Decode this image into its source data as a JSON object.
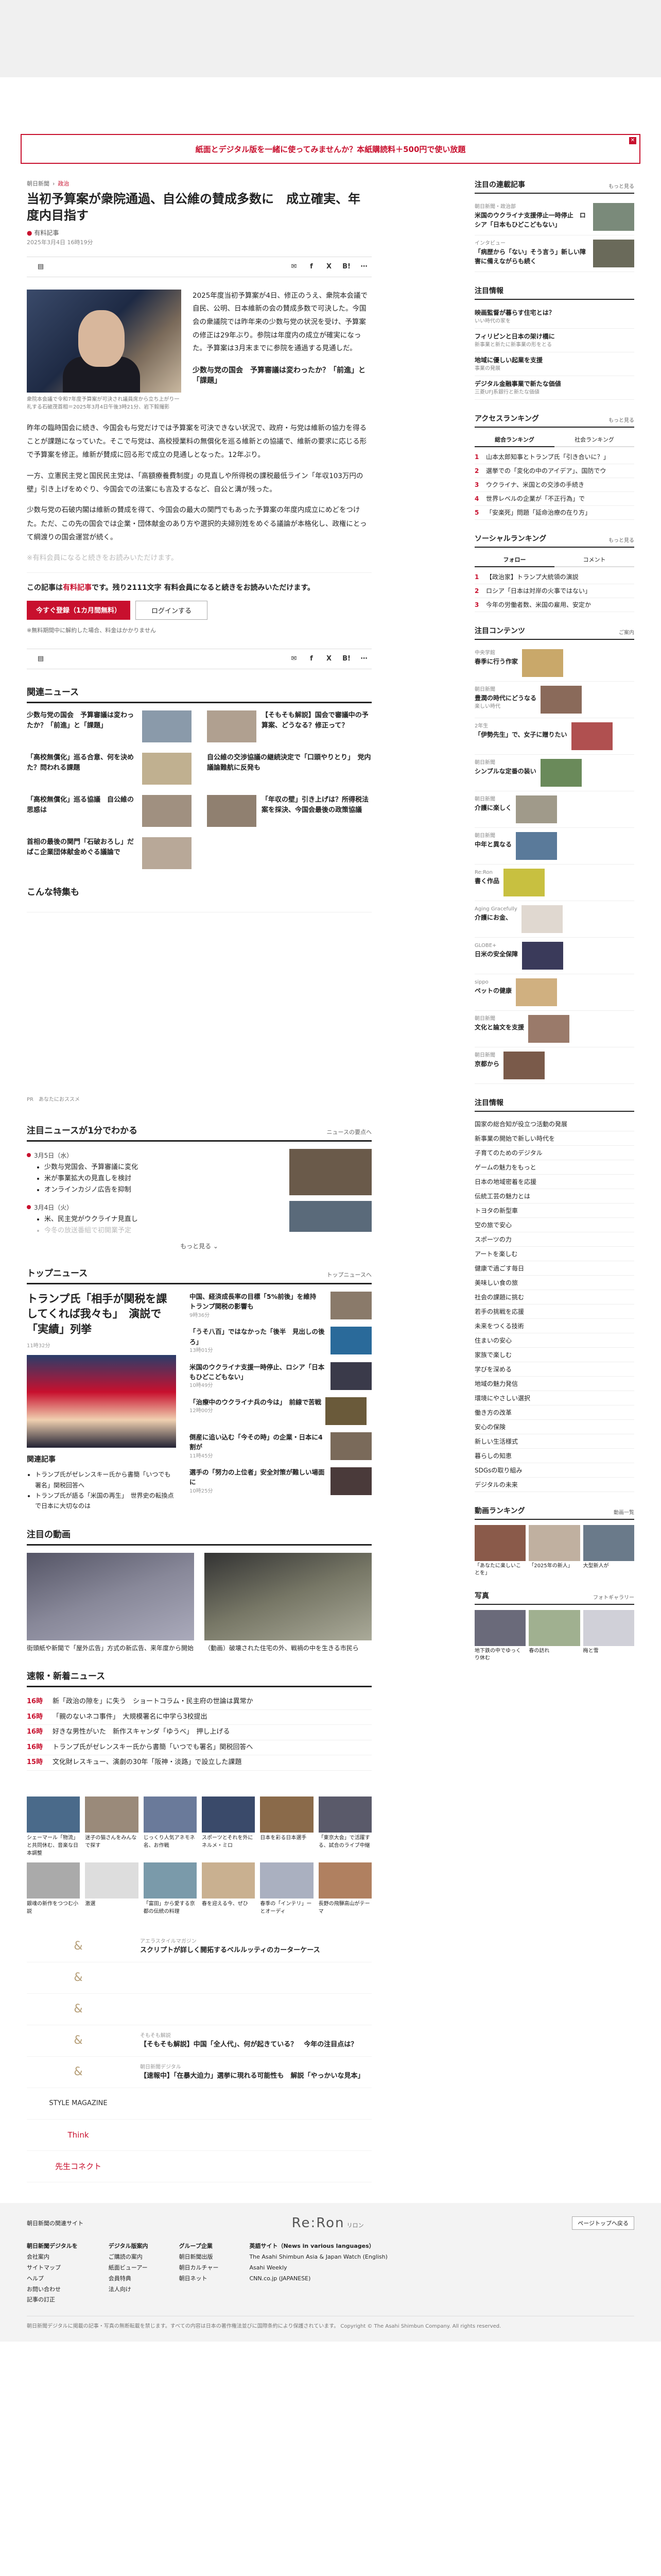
{
  "promo": {
    "text": "紙面とデジタル版を一緒に使ってみませんか？本紙購読料＋500円で使い放題",
    "close": "✕"
  },
  "article": {
    "breadcrumb": [
      "朝日新聞",
      "政治"
    ],
    "title": "当初予算案が衆院通過、自公維の賛成多数に　成立確実、年度内目指す",
    "author": "有料記事",
    "date": "2025年3月4日 16時19分",
    "photo_caption": "衆院本会議で令和7年度予算案が可決され議員席から立ち上がり一礼する石破茂首相＝2025年3月4日午後3時21分、岩下毅撮影",
    "lead": "2025年度当初予算案が4日、修正のうえ、衆院本会議で自民、公明、日本維新の会の賛成多数で可決した。今国会の衆議院では昨年来の少数与党の状況を受け、予算案の修正は29年ぶり。参院は年度内の成立が確実になった。予算案は3月末までに参院を通過する見通しだ。",
    "related_h": "少数与党の国会　予算審議は変わったか？「前進」と「課題」",
    "related_link": "→",
    "p1": "昨年の臨時国会に続き、今国会も与党だけでは予算案を可決できない状況で、政府・与党は維新の協力を得ることが課題になっていた。そこで与党は、高校授業料の無償化を巡る維新との協議で、維新の要求に応じる形で予算案を修正。維新が賛成に回る形で成立の見通しとなった。12年ぶり。",
    "p2": "一方、立憲民主党と国民民主党は、「高額療養費制度」の見直しや所得税の課税最低ライン「年収103万円の壁」引き上げをめぐり、今国会での法案にも言及するなど、自公と溝が残った。",
    "p3": "少数与党の石破内閣は維新の賛成を得て、今国会の最大の関門でもあった予算案の年度内成立にめどをつけた。ただ、この先の国会では企業・団体献金のあり方や選択的夫婦別姓をめぐる議論が本格化し、政権にとって綱渡りの国会運営が続く。",
    "p4": "※有料会員になると続きをお読みいただけます。",
    "paywall": {
      "text_pre": "この記事は",
      "text_red": "有料記事",
      "text_post": "です。残り2111文字 有料会員になると続きをお読みいただけます。",
      "subscribe": "今すぐ登録（1カ月間無料）",
      "login": "ログインする",
      "note": "※無料期間中に解約した場合、料金はかかりません"
    }
  },
  "share_icons": [
    "print-icon",
    "mail-icon",
    "facebook-icon",
    "x-icon",
    "hatena-icon",
    "more-icon"
  ],
  "share_glyphs": {
    "print": "▤",
    "mail": "✉",
    "facebook": "f",
    "x": "X",
    "hatena": "B!",
    "more": "⋯"
  },
  "related_news": {
    "heading": "関連ニュース",
    "items": [
      "少数与党の国会　予算審議は変わったか？「前進」と「課題」",
      "【そもそも解説】国会で審議中の予算案、どうなる？修正って？",
      "「高校無償化」巡る合意、何を決めた？問われる課題",
      "自公維の交渉協議の継続決定で「口頭やりとり」　党内議論難航に反発も",
      "「高校無償化」巡る協議　自公維の思惑は",
      "「年収の壁」引き上げは？所得税法案を採決、今国会最後の政策協議",
      "首相の最後の関門「石破おろし」だばこ企業団体献金めぐる議論で",
      ""
    ],
    "special_h": "こんな特集も"
  },
  "ad_label": "PR　あなたにおススメ",
  "timeline": {
    "heading": "注目ニュースが1分でわかる",
    "more_label": "ニュースの要点へ",
    "d1": "3月5日（水）",
    "d1_items": [
      "少数与党国会、予算審議に変化",
      "米が事業拡大の見直しを検討",
      "オンラインカジノ広告を抑制"
    ],
    "d2": "3月4日（火）",
    "d2_items": [
      "米、民主党がウクライナ見直し",
      "今冬の放送番組で初開業予定"
    ],
    "more": "もっと見る ⌄"
  },
  "top_news": {
    "heading": "トップニュース",
    "more": "トップニュースへ",
    "main_title": "トランプ氏「相手が関税を課してくれば我々も」　演説で「実績」列挙",
    "main_time": "11時32分",
    "right": [
      {
        "t": "中国、経済成長率の目標「5%前後」を維持　トランプ関税の影響も",
        "time": "9時36分"
      },
      {
        "t": "「うそ八百」ではなかった「後半　見出しの後ろ」",
        "time": "13時01分"
      },
      {
        "t": "米国のウクライナ支援一時停止、ロシア「日本もひどこどもない」",
        "time": "10時49分"
      },
      {
        "t": "「治療中のウクライナ兵の今は」　前線で苦戦",
        "time": "12時00分"
      },
      {
        "t": "倒産に追い込む「今その時」の企業・日本に4割が",
        "time": "11時45分"
      },
      {
        "t": "選手の「努力の上位者」安全対策が難しい場面に",
        "time": "10時25分"
      }
    ],
    "related_h": "関連記事",
    "related": [
      "トランプ氏がゼレンスキー氏から書簡「いつでも署名」関税回答へ",
      "トランプ氏が語る「米国の再生」　世界史の転換点で日本に大切なのは"
    ]
  },
  "videos": {
    "heading": "注目の動画",
    "items": [
      {
        "label": "新聞や屋外広告を見て、手探りの捜査への協力求め",
        "caption": "街頭紙や新聞で「屋外広告」方式の新広告、来年度から開始"
      },
      {
        "label": "ウクライナ・キーウ",
        "caption": "（動画）破壊された住宅の外、戦禍の中を生きる市民ら"
      }
    ]
  },
  "breaking": {
    "heading": "速報・新着ニュース",
    "items": [
      {
        "tm": "16時",
        "t": "新「政治の隙を」に失う　ショートコラム・民主府の世論は異常か"
      },
      {
        "tm": "16時",
        "t": "「親のないネコ事件」　大規模署名に中学ら3校提出"
      },
      {
        "tm": "16時",
        "t": "好きな男性がいた　新作スキャンダ「ゆうべ」　押し上げる"
      },
      {
        "tm": "16時",
        "t": "トランプ氏がゼレンスキー氏から書簡「いつでも署名」関税回答へ"
      },
      {
        "tm": "15時",
        "t": "文化財レスキュー、演劇の30年「阪神・淡路」で設立した課題"
      }
    ]
  },
  "banners": [
    "シェーマール「物流」と共同休む、音楽な日本調整",
    "迷子の猫さんをみんなで探す",
    "じっくり人気アネモネ名、お作戦",
    "スポーツとそれを外にネルメ・ミロ",
    "日本を彩る日本選手",
    "「東京大会」で活躍する、試合のライブ中継",
    "銀魂の新作をつつむ小説",
    "激選",
    "「富田」から愛する京都の伝統の料理",
    "春を迎える今、ぜひ",
    "春季の「インテリ」ーとオーディ",
    "長野の飛騨高山がテーマ"
  ],
  "sponsors": [
    {
      "logo": "&",
      "tag": "アエラスタイルマガジン",
      "t": "スクリプトが詳しく開拓するベルルッティのカーターケース"
    },
    {
      "logo": "&",
      "tag": "",
      "t": ""
    },
    {
      "logo": "&",
      "tag": "",
      "t": ""
    },
    {
      "logo": "&",
      "tag": "そもそも解説",
      "t": "【そもそも解説】中国「全人代」、何が起きている？　今年の注目点は？"
    },
    {
      "logo": "&",
      "tag": "朝日新聞デジタル",
      "t": "【速報中】「在暴大迫力」選挙に現れる可能性も　解説「やっかいな見本」"
    },
    {
      "logo": "STYLE MAGAZINE",
      "tag": "",
      "t": ""
    },
    {
      "logo": "Think",
      "tag": "",
      "t": ""
    },
    {
      "logo": "先生コネクト",
      "tag": "",
      "t": ""
    }
  ],
  "side": {
    "series": {
      "heading": "注目の連載記事",
      "more": "もっと見る",
      "items": [
        {
          "tag": "朝日新聞・政治部",
          "t": "米国のウクライナ支援停止一時停止　ロシア「日本もひどこどもない」"
        },
        {
          "tag": "インタビュー",
          "t": "「病歴から「ない」そう言う」新しい障害に備えながらも続く"
        }
      ]
    },
    "notice": {
      "heading": "注目情報",
      "items": [
        {
          "t": "映画監督が暮らす住宅とは？",
          "s": "いい時代の家を"
        },
        {
          "t": "フィリピンと日本の架け橋に",
          "s": "新事業と新たに新事業の形をとる"
        },
        {
          "t": "地域に優しい起業を支援",
          "s": "事業の発展"
        },
        {
          "t": "デジタル金融事業で新たな価値",
          "s": "三菱UFJ系銀行と新たな価値"
        }
      ]
    },
    "access": {
      "heading": "アクセスランキング",
      "more": "もっと見る",
      "tabs": [
        "総合ランキング",
        "社会ランキング"
      ],
      "items": [
        "山本太郎知事とトランプ氏「引き合いに？」",
        "選挙での「変化の中のアイデア」、国防でウ",
        "ウクライナ、米国との交渉の手続き",
        "世界レベルの企業が「不正行為」で",
        "「安楽死」問題「延命治療の在り方」"
      ]
    },
    "social": {
      "heading": "ソーシャルランキング",
      "more": "もっと見る",
      "tabs": [
        "フォロー",
        "コメント"
      ],
      "items": [
        "【政治家】トランプ大統領の演説",
        "ロシア「日本は対岸の火事ではない」",
        "今年の労働者数、米国の雇用、安定か"
      ]
    },
    "digital": {
      "heading": "注目コンテンツ",
      "more": "ご案内",
      "items": [
        {
          "tag": "中央学館",
          "t": "春季に行う作家",
          "s": ""
        },
        {
          "tag": "朝日新聞",
          "t": "豊潤の時代にどうなる",
          "s": "楽しい時代"
        },
        {
          "tag": "2年生",
          "t": "「伊勢先生」で、女子に贈りたい",
          "s": ""
        },
        {
          "tag": "朝日新聞",
          "t": "シンプルな定番の装い",
          "s": ""
        },
        {
          "tag": "朝日新聞",
          "t": "介護に楽しく",
          "s": ""
        },
        {
          "tag": "朝日新聞",
          "t": "中年と異なる",
          "s": ""
        },
        {
          "tag": "Re:Ron",
          "t": "書く作品",
          "s": ""
        },
        {
          "tag": "Aging Gracefully",
          "t": "介護にお金、",
          "s": ""
        },
        {
          "tag": "GLOBE+",
          "t": "日米の安全保障",
          "s": ""
        },
        {
          "tag": "sippo",
          "t": "ペットの健康",
          "s": ""
        },
        {
          "tag": "朝日新聞",
          "t": "文化と論文を支援",
          "s": ""
        },
        {
          "tag": "朝日新聞",
          "t": "京都から",
          "s": ""
        }
      ]
    },
    "info2": {
      "heading": "注目情報",
      "items": [
        "国家の総合知が役立つ活動の発展",
        "新事業の開始で新しい時代を",
        "子育てのためのデジタル",
        "ゲームの魅力をもっと",
        "日本の地域密着を応援",
        "伝統工芸の魅力とは",
        "トヨタの新型車",
        "空の旅で安心",
        "スポーツの力",
        "アートを楽しむ",
        "健康で過ごす毎日",
        "美味しい食の旅",
        "社会の課題に挑む",
        "若手の挑戦を応援",
        "未来をつくる技術",
        "住まいの安心",
        "家族で楽しむ",
        "学びを深める",
        "地域の魅力発信",
        "環境にやさしい選択",
        "働き方の改革",
        "安心の保険",
        "新しい生活様式",
        "暮らしの知恵",
        "SDGsの取り組み",
        "デジタルの未来"
      ]
    },
    "video_rank": {
      "heading": "動画ランキング",
      "more": "動画一覧",
      "items": [
        "「あなたに楽しいことを」",
        "「2025年の新人」",
        "大型新人が"
      ]
    },
    "photos": {
      "heading": "写真",
      "more": "フォトギャラリー",
      "items": [
        "地下鉄の中でゆっくり休む",
        "春の訪れ",
        "梅と雪"
      ]
    }
  },
  "footer": {
    "left": "朝日新聞の関連サイト",
    "logo": "Re:Ron",
    "logo_sub": "リロン",
    "ptop": "ページトップへ戻る",
    "cols": [
      {
        "h": "朝日新聞デジタルを",
        "items": [
          "会社案内",
          "サイトマップ",
          "ヘルプ",
          "お問い合わせ",
          "記事の訂正"
        ]
      },
      {
        "h": "デジタル版案内",
        "items": [
          "ご購読の案内",
          "紙面ビューアー",
          "会員特典",
          "法人向け"
        ]
      },
      {
        "h": "グループ企業",
        "items": [
          "朝日新聞出版",
          "朝日カルチャー",
          "朝日ネット"
        ]
      },
      {
        "h": "英語サイト（News in various languages）",
        "items": [
          "The Asahi Shimbun Asia & Japan Watch (English)",
          "Asahi Weekly",
          "CNN.co.jp (JAPANESE)"
        ]
      }
    ],
    "bottom": "朝日新聞デジタルに掲載の記事・写真の無断転載を禁じます。すべての内容は日本の著作権法並びに国際条約により保護されています。 Copyright © The Asahi Shimbun Company. All rights reserved."
  },
  "colors": {
    "accent": "#c8102e"
  }
}
